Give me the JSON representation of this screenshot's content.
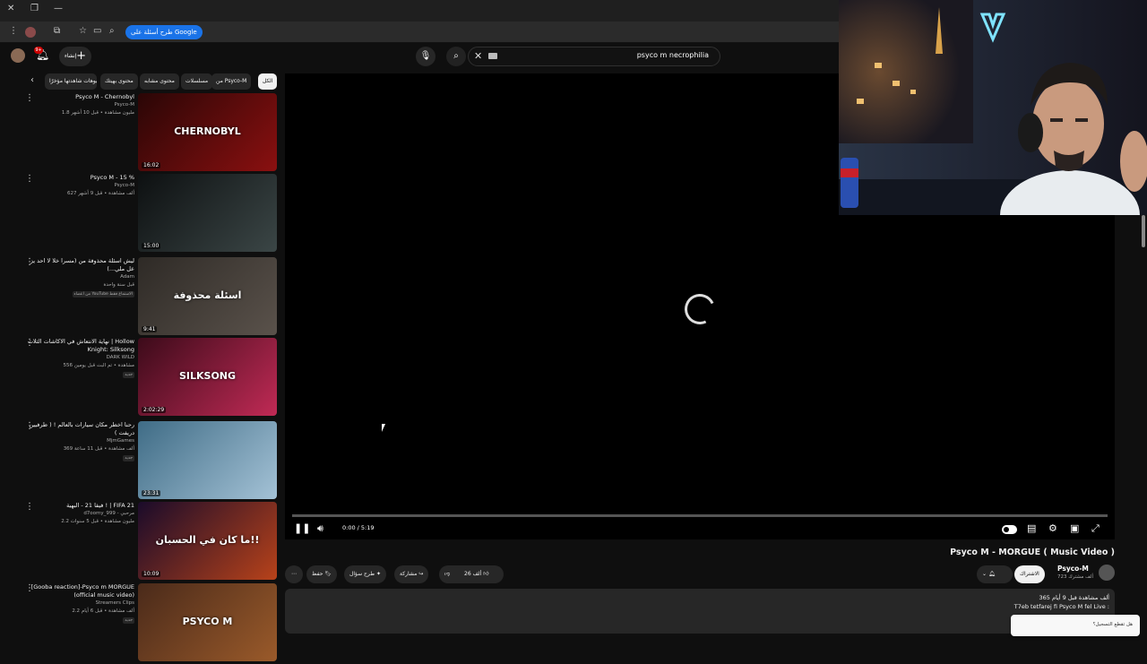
{
  "browser": {
    "address_pill": "طرح أسئلة على Google"
  },
  "youtube_header": {
    "search_value": "psyco m necrophilia",
    "create_label": "إنشاء",
    "notifications_count": "9+"
  },
  "chips": [
    "الكل",
    "من Psyco-M",
    "مسلسلات",
    "محتوى مشابه",
    "محتوى بهيتك",
    "فيديوهات شاهدتها مؤخرًا"
  ],
  "sidebar_videos": [
    {
      "title": "Psyco M - Chernobyl",
      "channel": "Psyco-M",
      "meta": "1.8 مليون مشاهدة • قبل 10 أشهر",
      "duration": "16:02",
      "badge": ""
    },
    {
      "title": "Psyco M - 15 %",
      "channel": "Psyco-M",
      "meta": "627 ألف مشاهدة • قبل 9 أشهر",
      "duration": "15:00",
      "badge": ""
    },
    {
      "title": "ليش اسئلة محذوفة من (مسرا خلا لا احد يز عل ملي...)",
      "channel": "Adam",
      "meta": "قبل سنة واحدة",
      "duration": "9:41",
      "badge": "من اعضاء YouTube الاستماع فقط"
    },
    {
      "title": "نهاية الانتعاش في الاكاشات الثلاث | Hollow Knight: Silksong",
      "channel": "DARK WILD",
      "meta": "556 مشاهدة • تم البث قبل يومين",
      "duration": "2:02:29",
      "badge": "جديد"
    },
    {
      "title": "رحنا اخطر مكان سيارات بالعالم ! ( طرفيين دريفت )",
      "channel": "MjmGames",
      "meta": "369 ألف مشاهدة • قبل 11 ساعة",
      "duration": "23:31",
      "badge": "جديد"
    },
    {
      "title": "فيفا 21 - البهية ! | FIFA 21",
      "channel": "d7oomy_999 - مرحبي",
      "meta": "2.2 مليون مشاهدة • قبل 5 سنوات",
      "duration": "10:09",
      "badge": ""
    },
    {
      "title": "[Gooba reaction]-Psyco m MORGUE (official music video)",
      "channel": "Streamers Clips",
      "meta": "2.2 ألف مشاهدة • قبل 6 أيام",
      "duration": "",
      "badge": "جديد"
    }
  ],
  "thumbnails": [
    {
      "caption": "CHERNOBYL",
      "bg1": "#2a0606",
      "bg2": "#8a1010"
    },
    {
      "caption": "",
      "bg1": "#0d1011",
      "bg2": "#3b4646"
    },
    {
      "caption": "اسئلة محذوفة",
      "bg1": "#2e2a26",
      "bg2": "#5a524b"
    },
    {
      "caption": "SILKSONG",
      "bg1": "#3c0b1a",
      "bg2": "#c02a55"
    },
    {
      "caption": "",
      "bg1": "#3f6c86",
      "bg2": "#a4c2d6"
    },
    {
      "caption": "ما كان في الحسبان!!",
      "bg1": "#1a0b2a",
      "bg2": "#b7421a"
    },
    {
      "caption": "PSYCO M",
      "bg1": "#4a2a1a",
      "bg2": "#9a5a2a"
    }
  ],
  "player": {
    "time": "0:00 / 5:19",
    "progress": 0.0
  },
  "video": {
    "title": "Psyco M - MORGUE ( Music Video )",
    "channel": "Psyco-M",
    "subscribers": "723 ألف مشترك",
    "join_label": "الاشتراك",
    "likes": "26 ألف",
    "share_label": "مشاركة",
    "ask_label": "طرح سؤال",
    "save_label": "حفظ",
    "desc_line1": "365 ألف مشاهدة قبل 9 أيام",
    "desc_line2": "T7eb tetfarej fi Psyco M fel Live :"
  },
  "toast": "هل تقطع التسجيل؟"
}
